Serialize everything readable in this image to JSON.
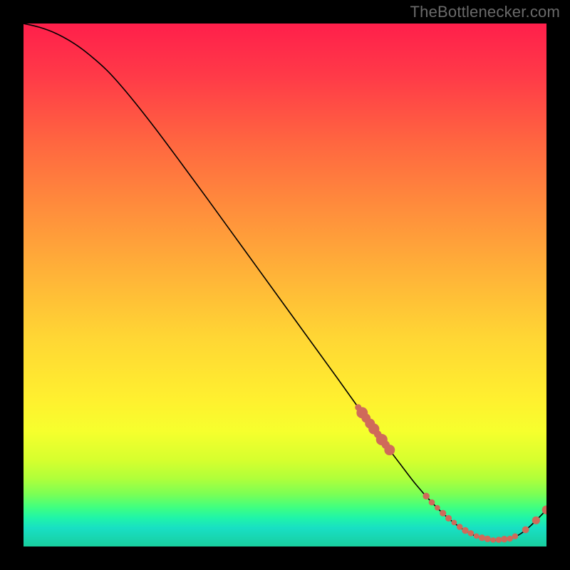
{
  "watermark": "TheBottlenecker.com",
  "chart_data": {
    "type": "line",
    "title": "",
    "xlabel": "",
    "ylabel": "",
    "xlim": [
      0,
      100
    ],
    "ylim": [
      0,
      100
    ],
    "series": [
      {
        "name": "curve",
        "x": [
          0,
          3,
          6,
          9,
          12,
          16,
          20,
          25,
          30,
          35,
          40,
          45,
          50,
          55,
          60,
          64,
          68,
          72,
          75,
          78,
          81,
          84,
          87,
          90,
          93,
          95,
          97,
          100
        ],
        "y": [
          100,
          99.3,
          98.2,
          96.6,
          94.5,
          91.0,
          86.5,
          80.2,
          73.5,
          66.7,
          59.8,
          52.9,
          46.0,
          39.1,
          32.2,
          26.6,
          21.1,
          15.8,
          11.9,
          8.5,
          5.6,
          3.3,
          1.8,
          1.2,
          1.5,
          2.4,
          4.0,
          7.0
        ]
      }
    ],
    "markers": [
      {
        "kind": "cluster",
        "x_range": [
          64,
          70
        ],
        "count": 9,
        "color": "#cf6a5a",
        "size": 14
      },
      {
        "kind": "bottom_row",
        "x_range": [
          77,
          93
        ],
        "count": 16,
        "color": "#cf6a5a",
        "size": 9
      },
      {
        "kind": "right_tail",
        "x_range": [
          94,
          100
        ],
        "count": 4,
        "color": "#cf6a5a",
        "size": 12
      }
    ],
    "gradient_stops": [
      {
        "pos": 0.0,
        "color": "#ff1f4b"
      },
      {
        "pos": 0.35,
        "color": "#ff8c3c"
      },
      {
        "pos": 0.72,
        "color": "#fff02f"
      },
      {
        "pos": 0.9,
        "color": "#7bff55"
      },
      {
        "pos": 1.0,
        "color": "#18ce9e"
      }
    ]
  }
}
